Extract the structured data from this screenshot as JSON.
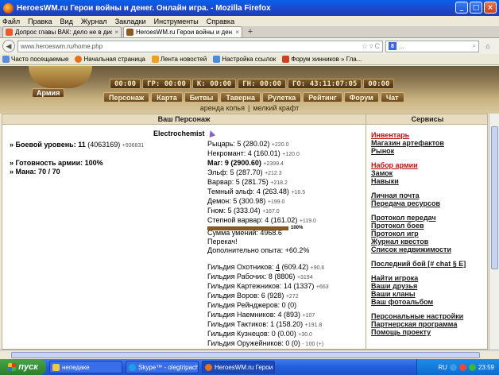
{
  "window": {
    "title": "HeroesWM.ru Герои войны и денег. Онлайн игра. - Mozilla Firefox",
    "minimize": "_",
    "maximize": "□",
    "close": "×"
  },
  "menu": [
    "Файл",
    "Правка",
    "Вид",
    "Журнал",
    "Закладки",
    "Инструменты",
    "Справка"
  ],
  "tabs": [
    {
      "label": "Допрос главы ВАК: дело не в диссерт...",
      "close": "×"
    },
    {
      "label": "HeroesWM.ru Герои войны и ден. Он...",
      "close": "×"
    }
  ],
  "new_tab": "+",
  "nav": {
    "url": "www.heroeswm.ru/home.php",
    "search_placeholder": "...",
    "search_engine": "8"
  },
  "bookmarks": [
    "Часто посещаемые",
    "Начальная страница",
    "Лента новостей",
    "Настройка ссылок",
    "Форум хинников » Гла..."
  ],
  "game": {
    "logo_text": "Герои",
    "stats": [
      "00:00",
      "ГР: 00:00",
      "К: 00:00",
      "ГН: 00:00",
      "ГО: 43:11:07:05",
      "00:00"
    ],
    "army_label": "Армия",
    "nav": [
      "Персонаж",
      "Карта",
      "Битвы",
      "Таверна",
      "Рулетка",
      "Рейтинг",
      "Форум",
      "Чат"
    ],
    "subnav": [
      "аренда копья",
      "|",
      "мелкий крафт"
    ]
  },
  "panels": {
    "left_title": "Ваш Персонаж",
    "right_title": "Сервисы"
  },
  "character": {
    "name": "Electrochemist",
    "combat_level_label": "» Боевой уровень: 11",
    "combat_level_exp": "(4063169)",
    "combat_level_delta": "+936831",
    "army_ready": "» Готовность армии: 100%",
    "mana": "» Мана: 70 / 70"
  },
  "factions": [
    {
      "text": "Рыцарь: 5 (280.02)",
      "delta": "+220.0",
      "bold": false
    },
    {
      "text": "Некромант: 4 (160.01)",
      "delta": "+120.0",
      "bold": false
    },
    {
      "text": "Маг: 9 (2900.60)",
      "delta": "+2399.4",
      "bold": true
    },
    {
      "text": "Эльф: 5 (287.70)",
      "delta": "+212.3",
      "bold": false
    },
    {
      "text": "Варвар: 5 (281.75)",
      "delta": "+218.2",
      "bold": false
    },
    {
      "text": "Темный эльф: 4 (263.48)",
      "delta": "+16.5",
      "bold": false
    },
    {
      "text": "Демон: 5 (300.98)",
      "delta": "+199.0",
      "bold": false
    },
    {
      "text": "Гном: 5 (333.04)",
      "delta": "+167.0",
      "bold": false
    },
    {
      "text": "Степной варвар: 4 (161.02)",
      "delta": "+119.0",
      "bold": false
    }
  ],
  "skills_sum": "Сумма умений: 4968.6",
  "progress": {
    "value": 100,
    "label": "100%"
  },
  "extra": [
    "Перекач!",
    "Дополнительно опыта: +60.2%"
  ],
  "guilds": [
    {
      "prefix": "Гильдия Охотников: ",
      "level": "4",
      "rest": " (609.42)",
      "delta": "+90.6"
    },
    {
      "prefix": "Гильдия Рабочих: ",
      "level": "",
      "rest": "8 (8806)",
      "delta": "+3194"
    },
    {
      "prefix": "Гильдия Картежников: ",
      "level": "",
      "rest": "14 (1337)",
      "delta": "+663"
    },
    {
      "prefix": "Гильдия Воров: ",
      "level": "",
      "rest": "6 (928)",
      "delta": "+272"
    },
    {
      "prefix": "Гильдия Рейнджеров: ",
      "level": "",
      "rest": "0 (0)",
      "delta": ""
    },
    {
      "prefix": "Гильдия Наемников: ",
      "level": "",
      "rest": "4 (893)",
      "delta": "+107"
    },
    {
      "prefix": "Гильдия Тактиков: ",
      "level": "",
      "rest": "1 (158.20)",
      "delta": "+191.8"
    },
    {
      "prefix": "Гильдия Кузнецов: ",
      "level": "",
      "rest": "0 (0.00)",
      "delta": "+30.0"
    },
    {
      "prefix": "Гильдия Оружейников: ",
      "level": "",
      "rest": "0 (0)",
      "delta": "- 100 (+)"
    }
  ],
  "services": [
    {
      "items": [
        {
          "label": "Инвентарь",
          "red": true
        },
        {
          "label": "Магазин артефактов",
          "red": false
        },
        {
          "label": "Рынок",
          "red": false
        }
      ]
    },
    {
      "items": [
        {
          "label": "Набор армии",
          "red": true
        },
        {
          "label": "Замок",
          "red": false
        },
        {
          "label": "Навыки",
          "red": false
        }
      ]
    },
    {
      "items": [
        {
          "label": "Личная почта",
          "red": false
        },
        {
          "label": "Передача ресурсов",
          "red": false
        }
      ]
    },
    {
      "items": [
        {
          "label": "Протокол передач",
          "red": false
        },
        {
          "label": "Протокол боев",
          "red": false
        },
        {
          "label": "Протокол игр",
          "red": false
        },
        {
          "label": "Журнал квестов",
          "red": false
        },
        {
          "label": "Список недвижимости",
          "red": false
        }
      ]
    },
    {
      "items": [
        {
          "label": "Последний бой [# chat § E]",
          "red": false
        }
      ]
    },
    {
      "items": [
        {
          "label": "Найти игрока",
          "red": false
        },
        {
          "label": "Ваши друзья",
          "red": false
        },
        {
          "label": "Ваши кланы",
          "red": false
        },
        {
          "label": "Ваш фотоальбом",
          "red": false
        }
      ]
    },
    {
      "items": [
        {
          "label": "Персональные настройки",
          "red": false
        },
        {
          "label": "Партнерская программа",
          "red": false
        },
        {
          "label": "Помощь проекту",
          "red": false
        }
      ]
    }
  ],
  "taskbar": {
    "start": "пуск",
    "tasks": [
      "непедаке",
      "Skype™ - olegtripach...",
      "HeroesWM.ru Герои ..."
    ],
    "lang": "RU",
    "clock": "23:59"
  }
}
